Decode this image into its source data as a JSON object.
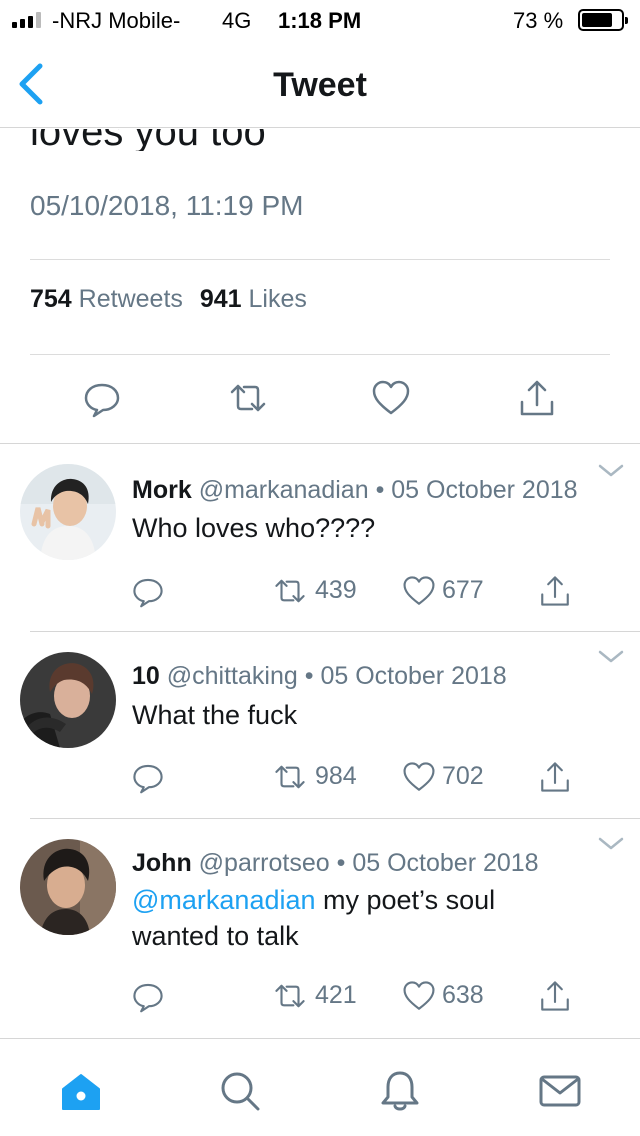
{
  "status_bar": {
    "carrier": "-NRJ Mobile-",
    "network": "4G",
    "time": "1:18 PM",
    "battery_percent": "73 %",
    "battery_level": 0.73
  },
  "navbar": {
    "title": "Tweet",
    "back_icon": "chevron-left-icon"
  },
  "tweet": {
    "clipped_text": "loves you too",
    "date": "05/10/2018, 11:19 PM",
    "retweets_count": "754",
    "retweets_label": "Retweets",
    "likes_count": "941",
    "likes_label": "Likes",
    "action_icons": [
      "reply-icon",
      "retweet-icon",
      "like-icon",
      "share-icon"
    ]
  },
  "replies": [
    {
      "name": "Mork",
      "handle": "@markanadian",
      "separator": "•",
      "date": "05 October 2018",
      "text": "Who loves who????",
      "retweets": "439",
      "likes": "677"
    },
    {
      "name": "10",
      "handle": "@chittaking",
      "separator": "•",
      "date": "05 October 2018",
      "text": "What the fuck",
      "retweets": "984",
      "likes": "702"
    },
    {
      "name": "John",
      "handle": "@parrotseo",
      "separator": "•",
      "date": "05 October 2018",
      "mention": "@markanadian",
      "text_line1": " my poet’s soul",
      "text_line2": "wanted to talk",
      "retweets": "421",
      "likes": "638"
    }
  ],
  "tabbar": {
    "tabs": [
      "home-icon",
      "search-icon",
      "notifications-icon",
      "messages-icon"
    ],
    "active": "home-icon"
  },
  "colors": {
    "accent": "#1da1f2",
    "secondary_text": "#657786",
    "primary_text": "#14171a",
    "divider": "#d6d6d6"
  }
}
